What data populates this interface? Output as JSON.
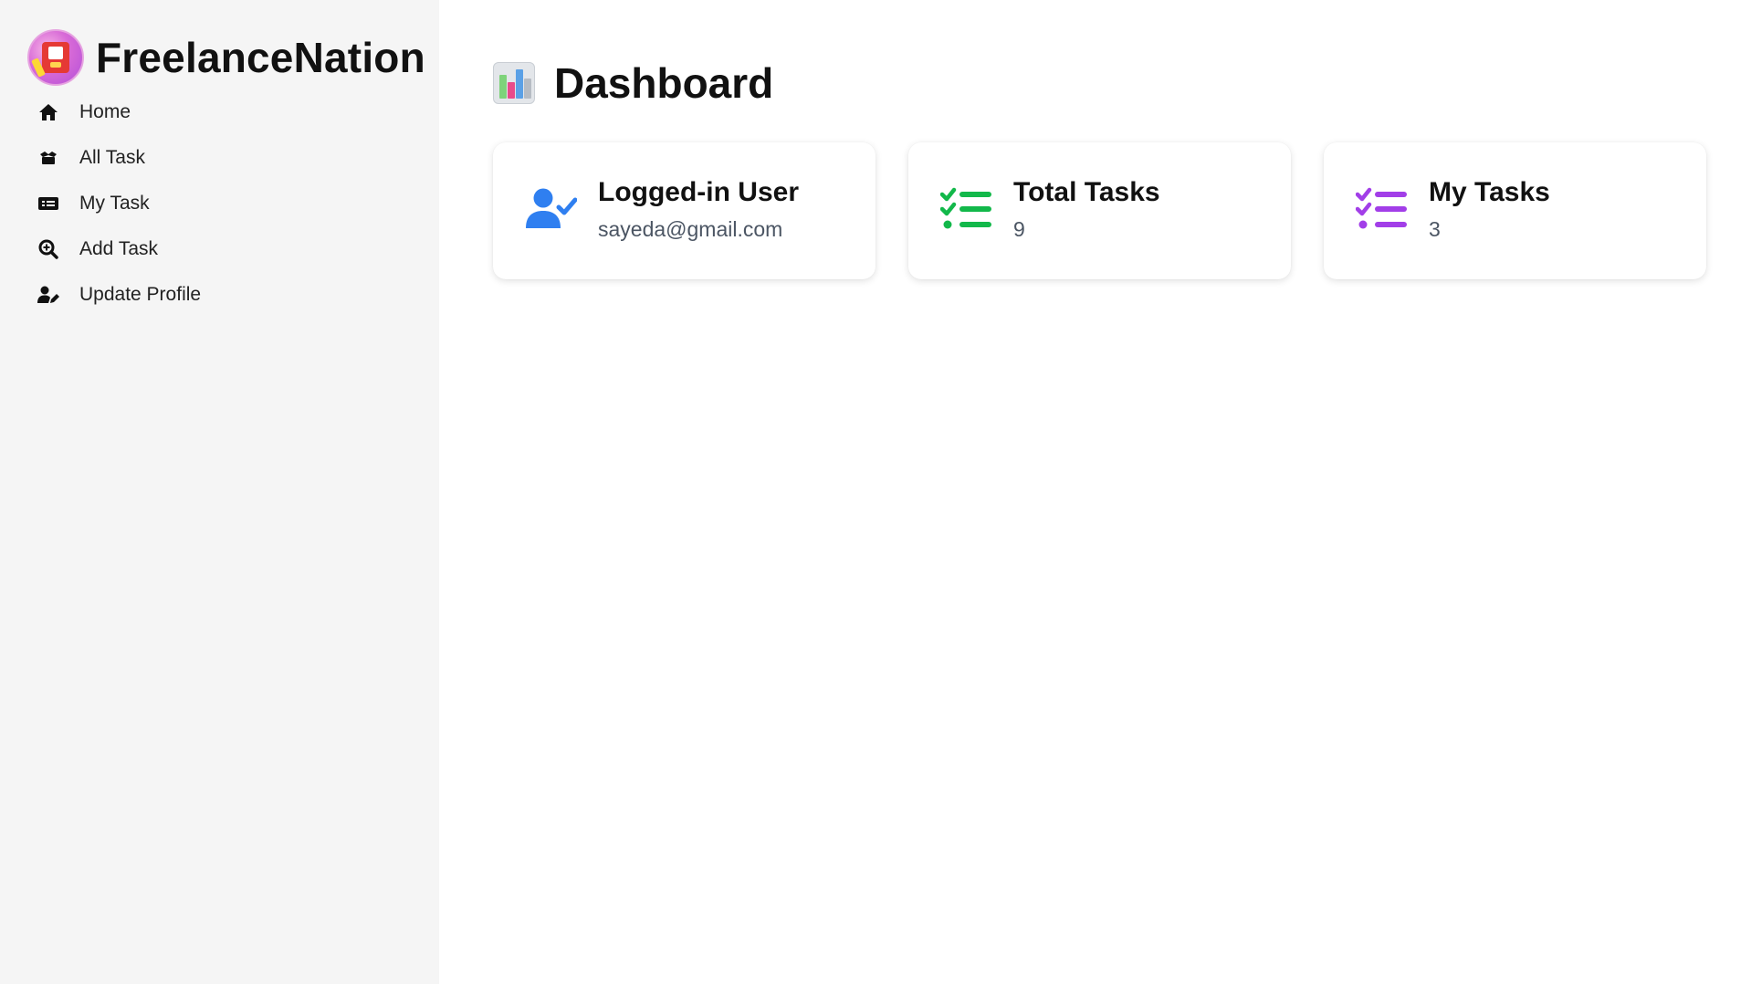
{
  "brand": {
    "name": "FreelanceNation"
  },
  "sidebar": {
    "items": [
      {
        "label": "Home",
        "icon": "home-icon"
      },
      {
        "label": "All Task",
        "icon": "tasks-box-icon"
      },
      {
        "label": "My Task",
        "icon": "list-card-icon"
      },
      {
        "label": "Add Task",
        "icon": "search-plus-icon"
      },
      {
        "label": "Update Profile",
        "icon": "user-edit-icon"
      }
    ]
  },
  "page": {
    "title": "Dashboard",
    "icon": "bar-chart-icon"
  },
  "cards": [
    {
      "title": "Logged-in User",
      "value": "sayeda@gmail.com",
      "icon": "user-check-icon",
      "color": "#2f7ff0"
    },
    {
      "title": "Total Tasks",
      "value": "9",
      "icon": "checklist-icon",
      "color": "#12b84a"
    },
    {
      "title": "My Tasks",
      "value": "3",
      "icon": "checklist-icon",
      "color": "#a23ee8"
    }
  ]
}
